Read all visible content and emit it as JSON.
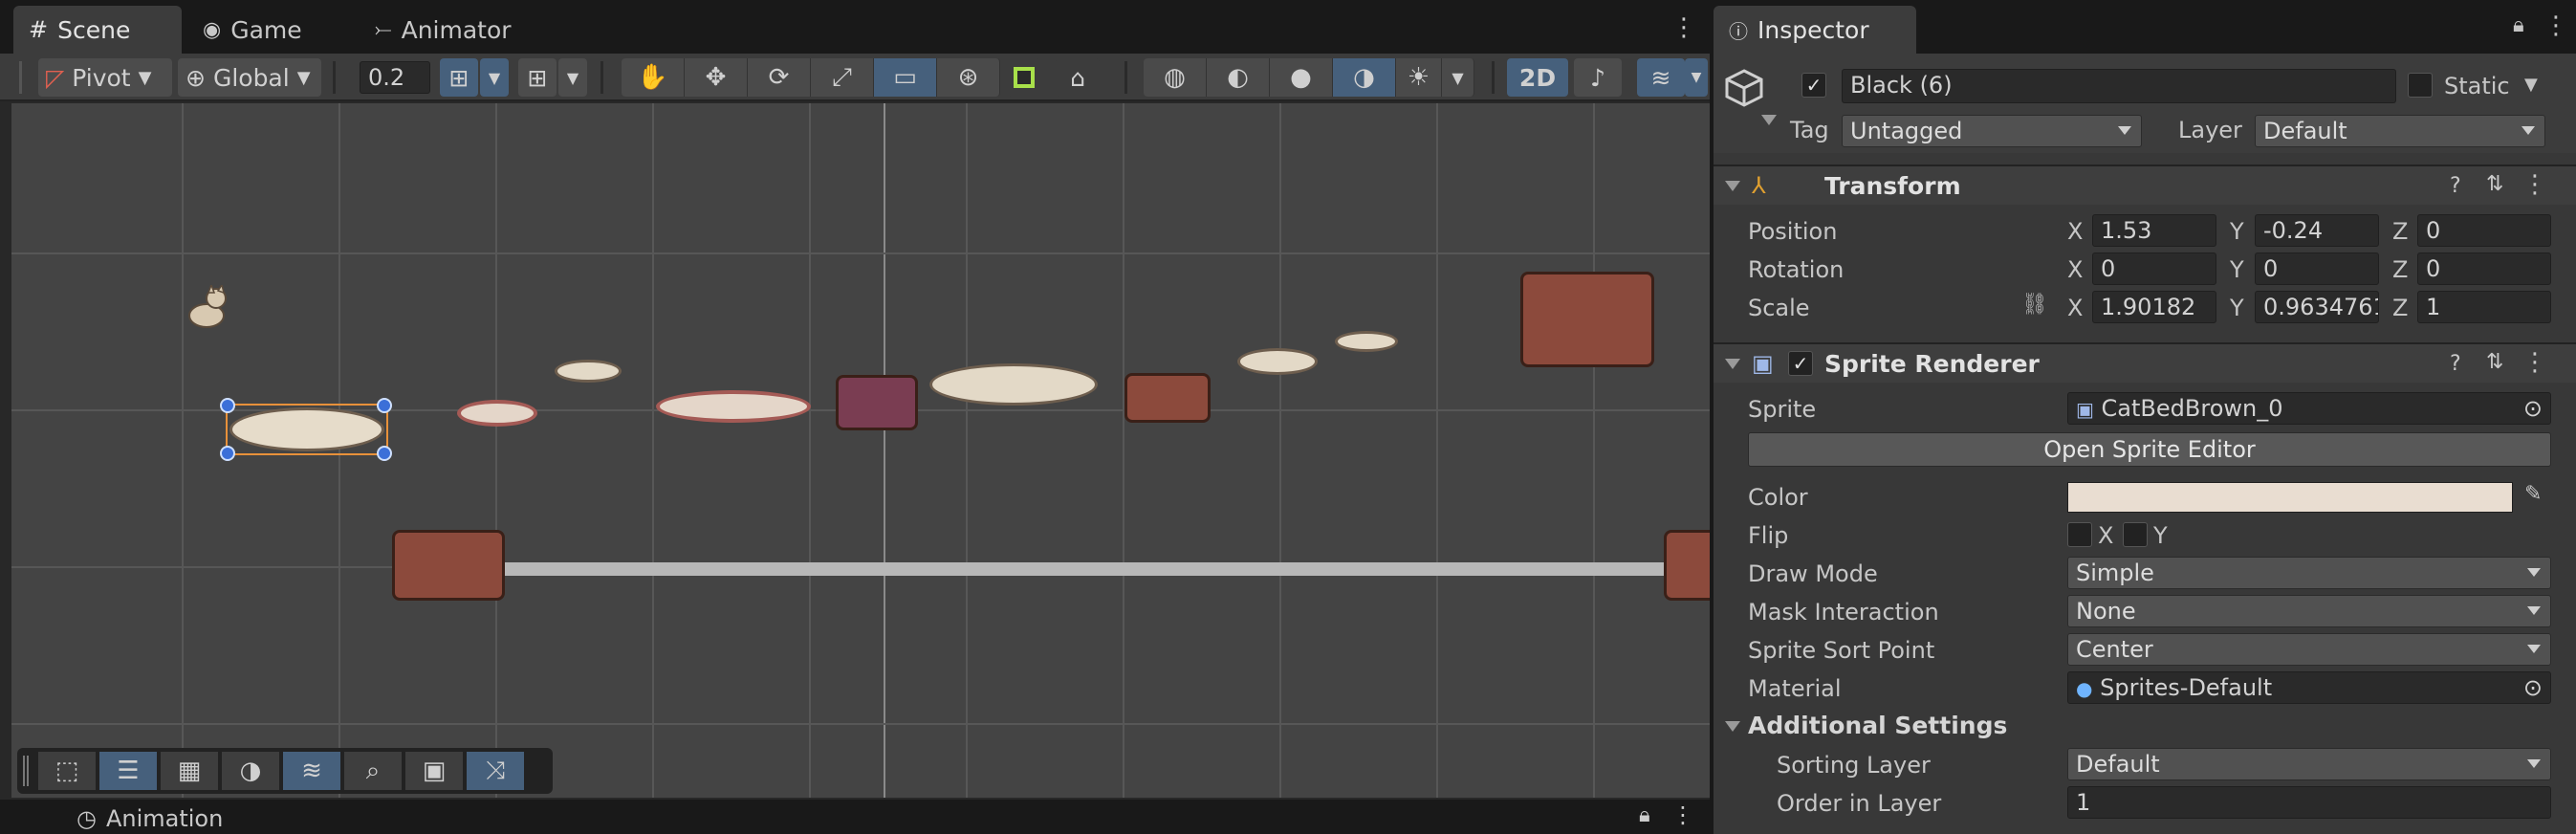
{
  "scene_tabs": [
    {
      "label": "Scene",
      "icon": "grid-icon"
    },
    {
      "label": "Game",
      "icon": "gamepad-icon"
    },
    {
      "label": "Animator",
      "icon": "animator-icon"
    }
  ],
  "toolbar": {
    "pivot": "Pivot",
    "global": "Global",
    "snap_value": "0.2",
    "mode_2d": "2D"
  },
  "bottom_panel": {
    "animation_tab": "Animation"
  },
  "inspector": {
    "tab_label": "Inspector",
    "object_name": "Black (6)",
    "static_label": "Static",
    "tag_label": "Tag",
    "tag_value": "Untagged",
    "layer_label": "Layer",
    "layer_value": "Default",
    "transform": {
      "title": "Transform",
      "position_label": "Position",
      "rotation_label": "Rotation",
      "scale_label": "Scale",
      "position": {
        "x": "1.53",
        "y": "-0.24",
        "z": "0"
      },
      "rotation": {
        "x": "0",
        "y": "0",
        "z": "0"
      },
      "scale": {
        "x": "1.90182",
        "y": "0.9634761",
        "z": "1"
      },
      "axis_x": "X",
      "axis_y": "Y",
      "axis_z": "Z"
    },
    "sprite_renderer": {
      "title": "Sprite Renderer",
      "sprite_label": "Sprite",
      "sprite_value": "CatBedBrown_0",
      "open_editor": "Open Sprite Editor",
      "color_label": "Color",
      "color_value": "#e9ddd1",
      "flip_label": "Flip",
      "flip_x": "X",
      "flip_y": "Y",
      "draw_mode_label": "Draw Mode",
      "draw_mode_value": "Simple",
      "mask_label": "Mask Interaction",
      "mask_value": "None",
      "sort_point_label": "Sprite Sort Point",
      "sort_point_value": "Center",
      "material_label": "Material",
      "material_value": "Sprites-Default",
      "additional_settings": "Additional Settings",
      "sorting_layer_label": "Sorting Layer",
      "sorting_layer_value": "Default",
      "order_label": "Order in Layer",
      "order_value": "1"
    }
  },
  "colors": {
    "accent": "#46607c",
    "selection": "#e8913a",
    "handle": "#3b6fd8"
  }
}
